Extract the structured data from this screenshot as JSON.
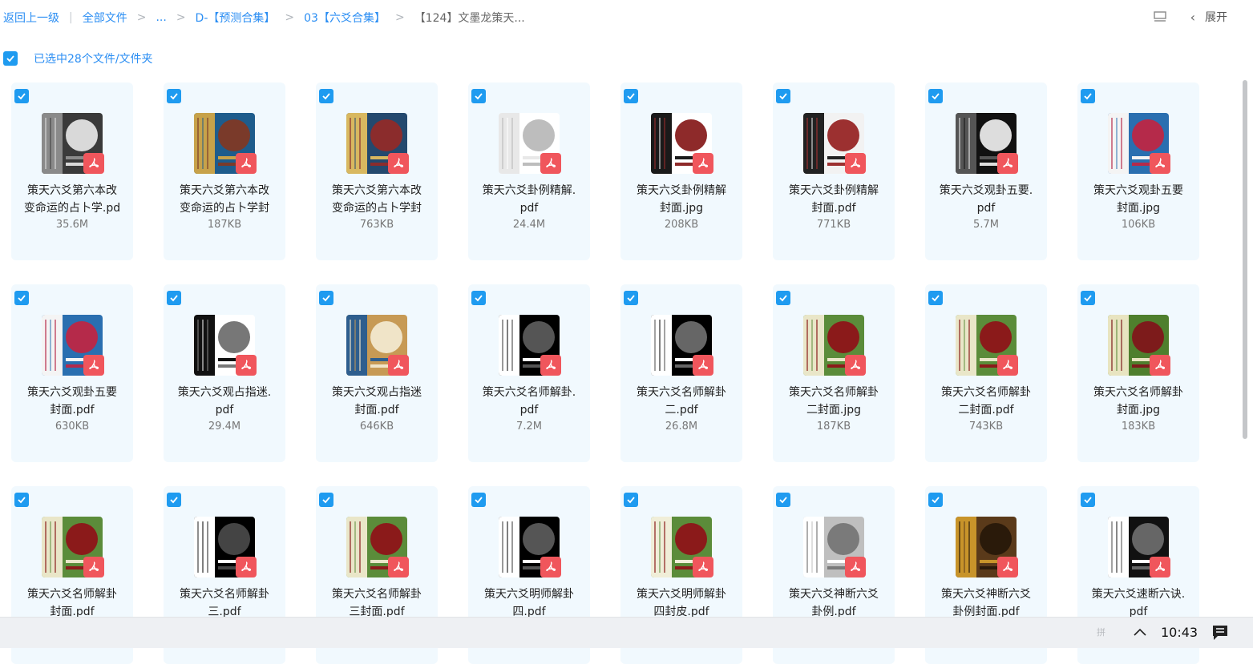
{
  "breadcrumb": {
    "back": "返回上一级",
    "root": "全部文件",
    "ellipsis": "...",
    "level1": "D-【预测合集】",
    "level2": "03【六爻合集】",
    "current": "【124】文墨龙策天..."
  },
  "toolbar": {
    "expand_label": "展开",
    "list_icon": "list-view-icon",
    "chevron_icon": "chevron-left-icon"
  },
  "selection": {
    "text": "已选中28个文件/文件夹"
  },
  "colors": {
    "accent": "#2b8ef3",
    "checkbox": "#1f9bf0",
    "card_bg": "#f1f9fe",
    "pdf_badge": "#f0565c"
  },
  "files": [
    {
      "line1": "策天六爻第六本改",
      "line2": "变命运的占卜学.pd",
      "size": "35.6M",
      "pdf": true
    },
    {
      "line1": "策天六爻第六本改",
      "line2": "变命运的占卜学封",
      "size": "187KB",
      "pdf": true
    },
    {
      "line1": "策天六爻第六本改",
      "line2": "变命运的占卜学封",
      "size": "763KB",
      "pdf": true
    },
    {
      "line1": "策天六爻卦例精解.",
      "line2": "pdf",
      "size": "24.4M",
      "pdf": true
    },
    {
      "line1": "策天六爻卦例精解",
      "line2": "封面.jpg",
      "size": "208KB",
      "pdf": true
    },
    {
      "line1": "策天六爻卦例精解",
      "line2": "封面.pdf",
      "size": "771KB",
      "pdf": true
    },
    {
      "line1": "策天六爻观卦五要.",
      "line2": "pdf",
      "size": "5.7M",
      "pdf": true
    },
    {
      "line1": "策天六爻观卦五要",
      "line2": "封面.jpg",
      "size": "106KB",
      "pdf": true
    },
    {
      "line1": "策天六爻观卦五要",
      "line2": "封面.pdf",
      "size": "630KB",
      "pdf": true
    },
    {
      "line1": "策天六爻观占指迷.",
      "line2": "pdf",
      "size": "29.4M",
      "pdf": true
    },
    {
      "line1": "策天六爻观占指迷",
      "line2": "封面.pdf",
      "size": "646KB",
      "pdf": true
    },
    {
      "line1": "策天六爻名师解卦.",
      "line2": "pdf",
      "size": "7.2M",
      "pdf": true
    },
    {
      "line1": "策天六爻名师解卦",
      "line2": "二.pdf",
      "size": "26.8M",
      "pdf": true
    },
    {
      "line1": "策天六爻名师解卦",
      "line2": "二封面.jpg",
      "size": "187KB",
      "pdf": true
    },
    {
      "line1": "策天六爻名师解卦",
      "line2": "二封面.pdf",
      "size": "743KB",
      "pdf": true
    },
    {
      "line1": "策天六爻名师解卦",
      "line2": "封面.jpg",
      "size": "183KB",
      "pdf": true
    },
    {
      "line1": "策天六爻名师解卦",
      "line2": "封面.pdf",
      "size": "",
      "pdf": true
    },
    {
      "line1": "策天六爻名师解卦",
      "line2": "三.pdf",
      "size": "",
      "pdf": true
    },
    {
      "line1": "策天六爻名师解卦",
      "line2": "三封面.pdf",
      "size": "",
      "pdf": true
    },
    {
      "line1": "策天六爻明师解卦",
      "line2": "四.pdf",
      "size": "",
      "pdf": true
    },
    {
      "line1": "策天六爻明师解卦",
      "line2": "四封皮.pdf",
      "size": "",
      "pdf": true
    },
    {
      "line1": "策天六爻神断六爻",
      "line2": "卦例.pdf",
      "size": "",
      "pdf": true
    },
    {
      "line1": "策天六爻神断六爻",
      "line2": "卦例封面.pdf",
      "size": "",
      "pdf": true
    },
    {
      "line1": "策天六爻速断六诀.",
      "line2": "pdf",
      "size": "",
      "pdf": true
    }
  ],
  "taskbar": {
    "time": "10:43",
    "faint": "拼"
  }
}
